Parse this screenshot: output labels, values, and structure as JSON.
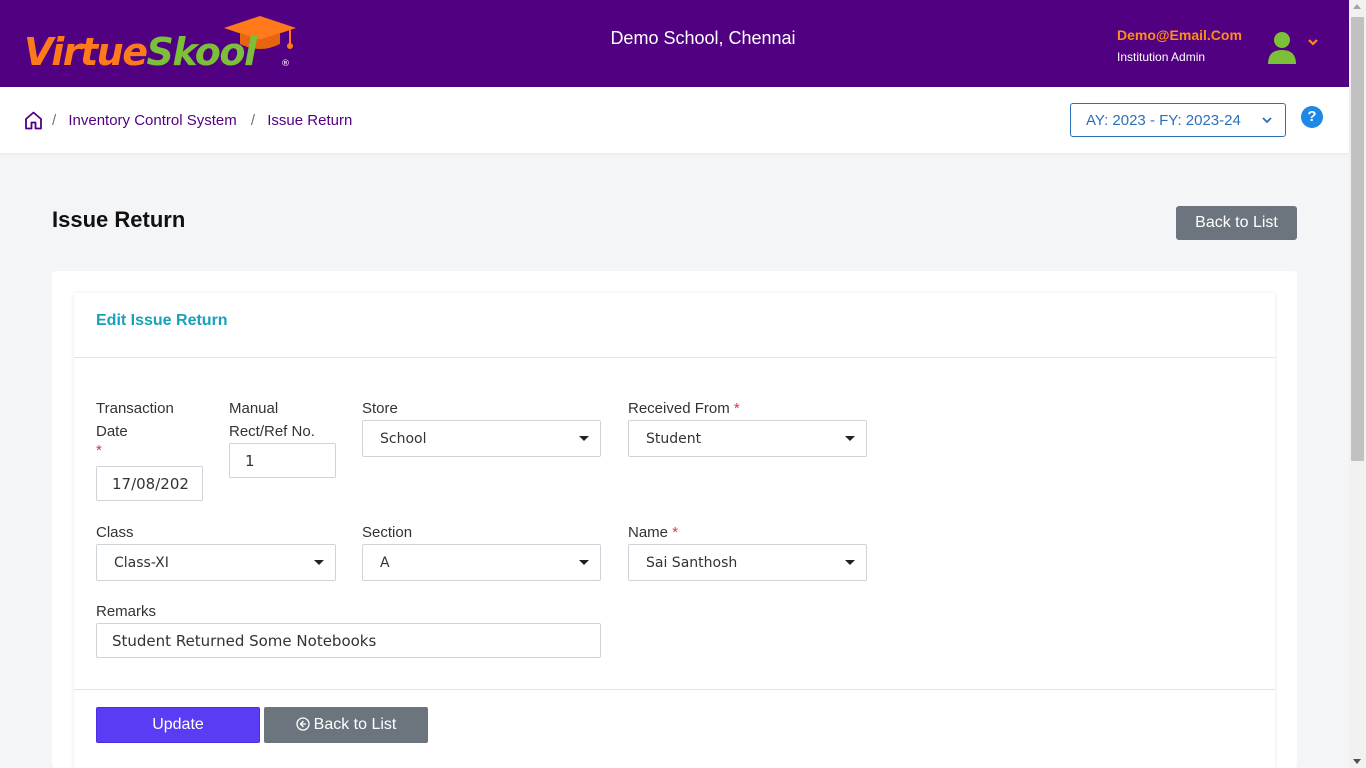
{
  "header": {
    "logo_virtue": "Virtue",
    "logo_skool": "Skool",
    "logo_reg": "®",
    "school_name": "Demo School, Chennai",
    "user_email": "Demo@Email.Com",
    "user_role": "Institution Admin"
  },
  "breadcrumb": {
    "sep": "/",
    "items": [
      "Inventory Control System",
      "Issue Return"
    ]
  },
  "year_selector": {
    "value": "AY: 2023 - FY: 2023-24"
  },
  "help": {
    "label": "?"
  },
  "page": {
    "title": "Issue Return",
    "back_to_list": "Back to List"
  },
  "form": {
    "card_title": "Edit Issue Return",
    "required_mark": "*",
    "transaction_date": {
      "label_line1": "Transaction",
      "label_line2": "Date",
      "value": "17/08/202"
    },
    "manual_ref": {
      "label_line1": "Manual",
      "label_line2": "Rect/Ref No.",
      "value": "1"
    },
    "store": {
      "label": "Store",
      "value": "School"
    },
    "received_from": {
      "label": "Received From",
      "value": "Student"
    },
    "class": {
      "label": "Class",
      "value": "Class-XI"
    },
    "section": {
      "label": "Section",
      "value": "A"
    },
    "name": {
      "label": "Name",
      "value": "Sai Santhosh"
    },
    "remarks": {
      "label": "Remarks",
      "value": "Student Returned Some Notebooks"
    },
    "update_button": "Update",
    "back_button": "Back to List"
  },
  "colors": {
    "header_bg": "#520082",
    "accent_orange": "#ff7a1a",
    "accent_green": "#7cc03a",
    "primary_button": "#5b3cf5",
    "secondary_button": "#6c757d",
    "card_title": "#17a2b8",
    "link": "#2c6fbb"
  },
  "icons": [
    "graduation-cap-icon",
    "user-avatar-icon",
    "chevron-down-icon",
    "home-icon",
    "help-icon",
    "caret-down-icon",
    "arrow-left-circle-icon"
  ]
}
